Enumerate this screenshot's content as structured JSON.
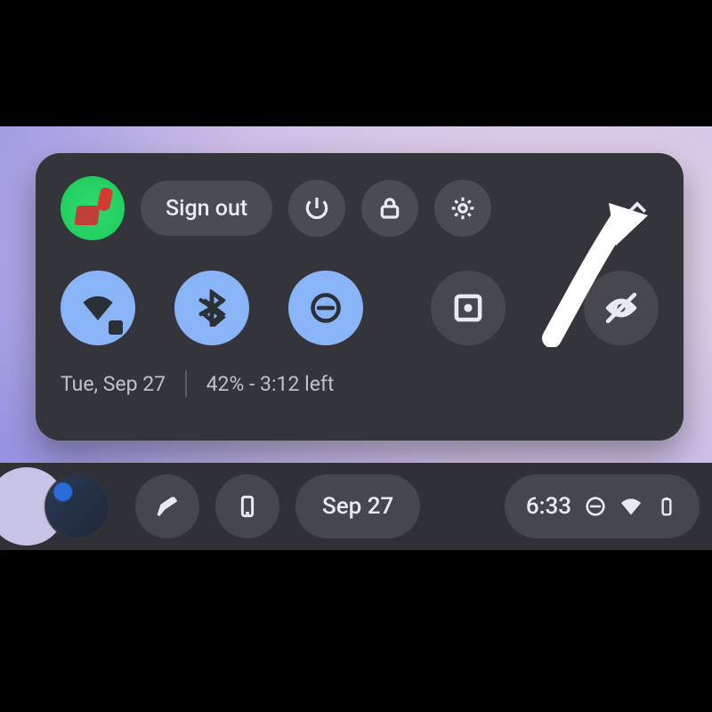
{
  "panel": {
    "sign_out_label": "Sign out",
    "date_line": "Tue, Sep 27",
    "battery_line": "42% - 3:12 left",
    "toggles": {
      "wifi": {
        "on": true
      },
      "bluetooth": {
        "on": true
      },
      "dnd": {
        "on": true
      },
      "screencast": {
        "on": false
      },
      "visibility_off": {
        "on": false
      }
    }
  },
  "shelf": {
    "date_label": "Sep 27",
    "time_label": "6:33"
  }
}
